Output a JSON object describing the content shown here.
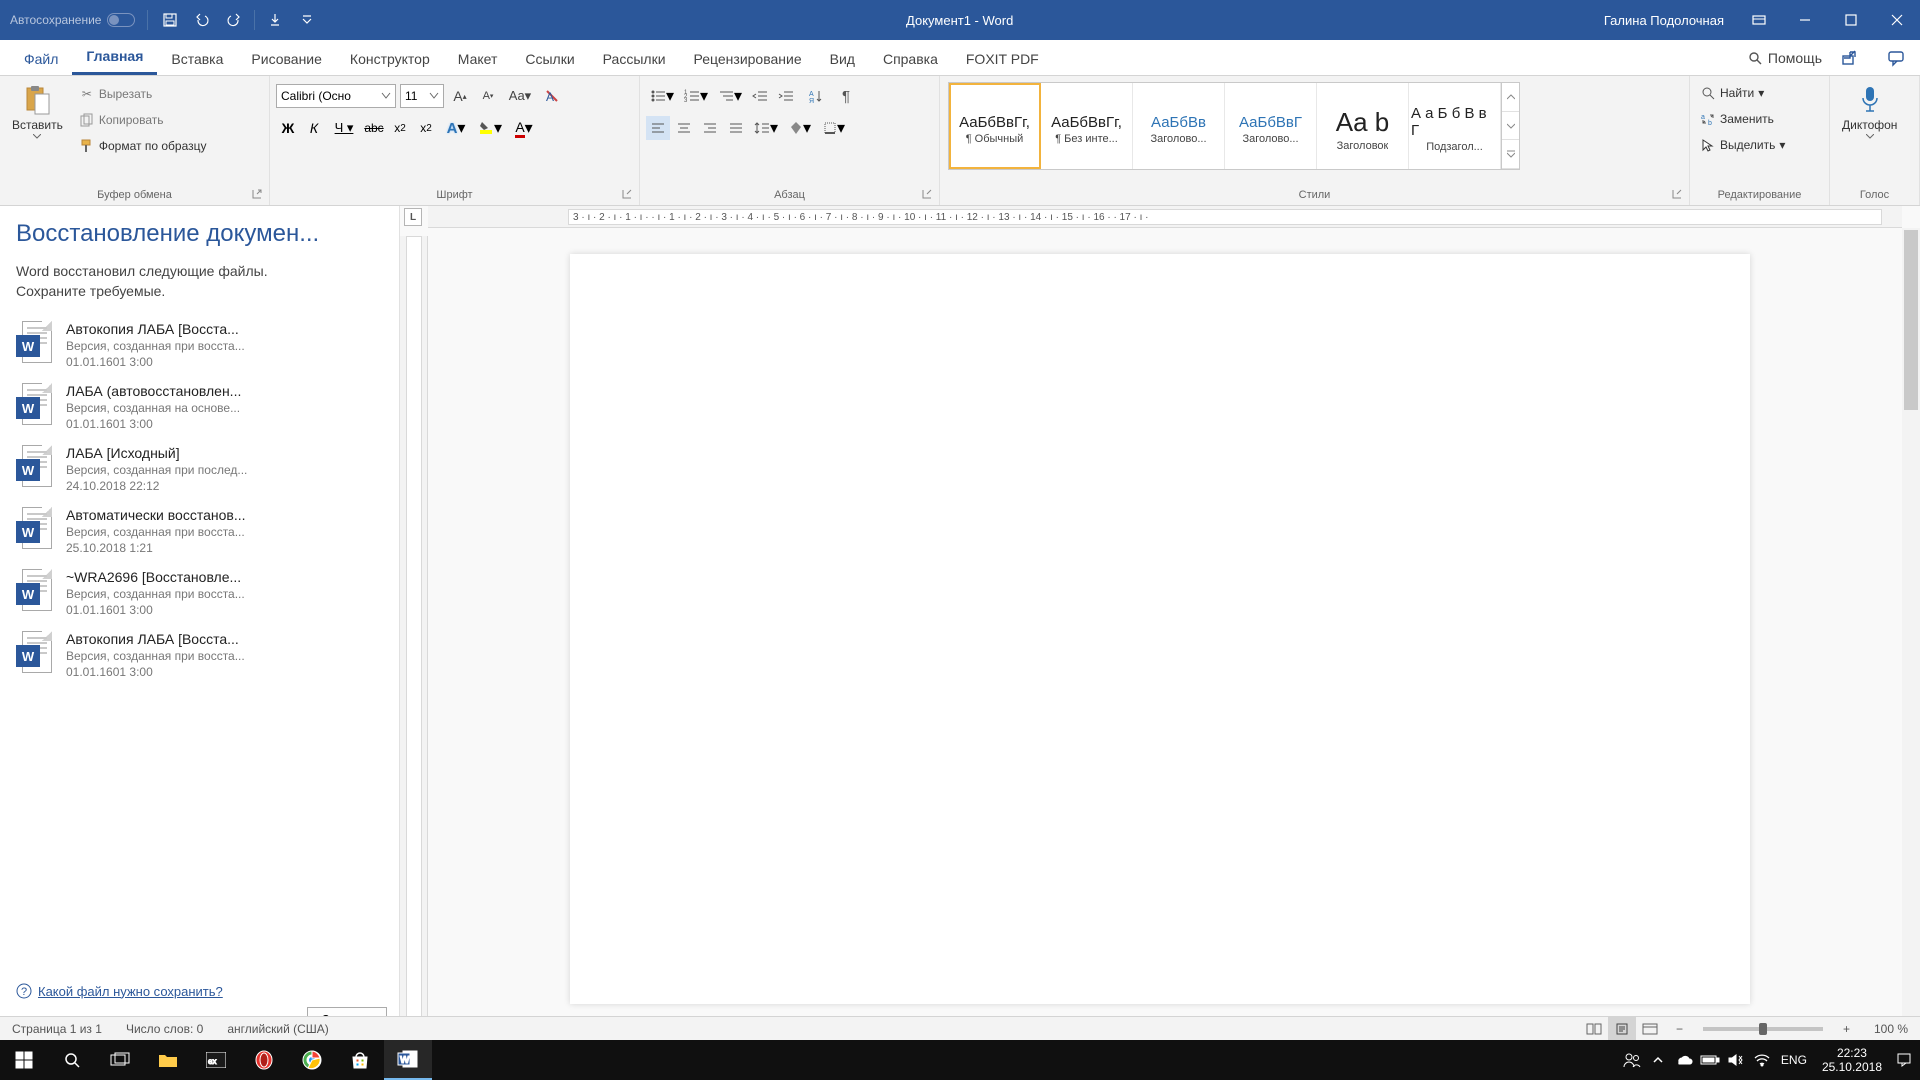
{
  "titlebar": {
    "autosave": "Автосохранение",
    "doc_title": "Документ1  -  Word",
    "user": "Галина Подолочная"
  },
  "tabs": {
    "file": "Файл",
    "home": "Главная",
    "insert": "Вставка",
    "draw": "Рисование",
    "design": "Конструктор",
    "layout": "Макет",
    "references": "Ссылки",
    "mailings": "Рассылки",
    "review": "Рецензирование",
    "view": "Вид",
    "help_tab": "Справка",
    "foxit": "FOXIT PDF",
    "help": "Помощь"
  },
  "ribbon": {
    "clipboard": {
      "label": "Буфер обмена",
      "paste": "Вставить",
      "cut": "Вырезать",
      "copy": "Копировать",
      "format_painter": "Формат по образцу"
    },
    "font": {
      "label": "Шрифт",
      "name": "Calibri (Осно",
      "size": "11"
    },
    "paragraph": {
      "label": "Абзац"
    },
    "styles": {
      "label": "Стили",
      "items": [
        {
          "preview": "АаБбВвГг,",
          "name": "¶ Обычный",
          "cls": ""
        },
        {
          "preview": "АаБбВвГг,",
          "name": "¶ Без инте...",
          "cls": ""
        },
        {
          "preview": "АаБбВв",
          "name": "Заголово...",
          "cls": "blue"
        },
        {
          "preview": "АаБбВвГ",
          "name": "Заголово...",
          "cls": "blue"
        },
        {
          "preview": "Aa b",
          "name": "Заголовок",
          "cls": "big"
        },
        {
          "preview": "А а Б б В в Г",
          "name": "Подзагол...",
          "cls": ""
        }
      ]
    },
    "editing": {
      "label": "Редактирование",
      "find": "Найти",
      "replace": "Заменить",
      "select": "Выделить"
    },
    "voice": {
      "label": "Голос",
      "dictate": "Диктофон"
    }
  },
  "recovery": {
    "title": "Восстановление докумен...",
    "subtitle1": "Word восстановил следующие файлы.",
    "subtitle2": "Сохраните требуемые.",
    "items": [
      {
        "title": "Автокопия ЛАБА  [Восста...",
        "desc": "Версия, созданная при восста...",
        "date": "01.01.1601 3:00"
      },
      {
        "title": "ЛАБА  (автовосстановлен...",
        "desc": "Версия, созданная на основе...",
        "date": "01.01.1601 3:00"
      },
      {
        "title": "ЛАБА  [Исходный]",
        "desc": "Версия, созданная при послед...",
        "date": "24.10.2018 22:12"
      },
      {
        "title": "Автоматически восстанов...",
        "desc": "Версия, созданная при восста...",
        "date": "25.10.2018 1:21"
      },
      {
        "title": "~WRA2696  [Восстановле...",
        "desc": "Версия, созданная при восста...",
        "date": "01.01.1601 3:00"
      },
      {
        "title": "Автокопия ЛАБА  [Восста...",
        "desc": "Версия, созданная при восста...",
        "date": "01.01.1601 3:00"
      }
    ],
    "help_link": "Какой файл нужно сохранить?",
    "close": "Закрыть"
  },
  "ruler": {
    "h": "3 · ı · 2 · ı · 1 · ı ·     · ı · 1 · ı · 2 · ı · 3 · ı · 4 · ı · 5 · ı · 6 · ı · 7 · ı · 8 · ı · 9 · ı · 10 · ı · 11 · ı · 12 · ı · 13 · ı · 14 · ı · 15 · ı · 16 ·    · 17 · ı ·"
  },
  "status": {
    "page": "Страница 1 из 1",
    "words": "Число слов: 0",
    "lang": "английский (США)",
    "zoom": "100 %"
  },
  "tray": {
    "lang": "ENG",
    "time": "22:23",
    "date": "25.10.2018"
  }
}
